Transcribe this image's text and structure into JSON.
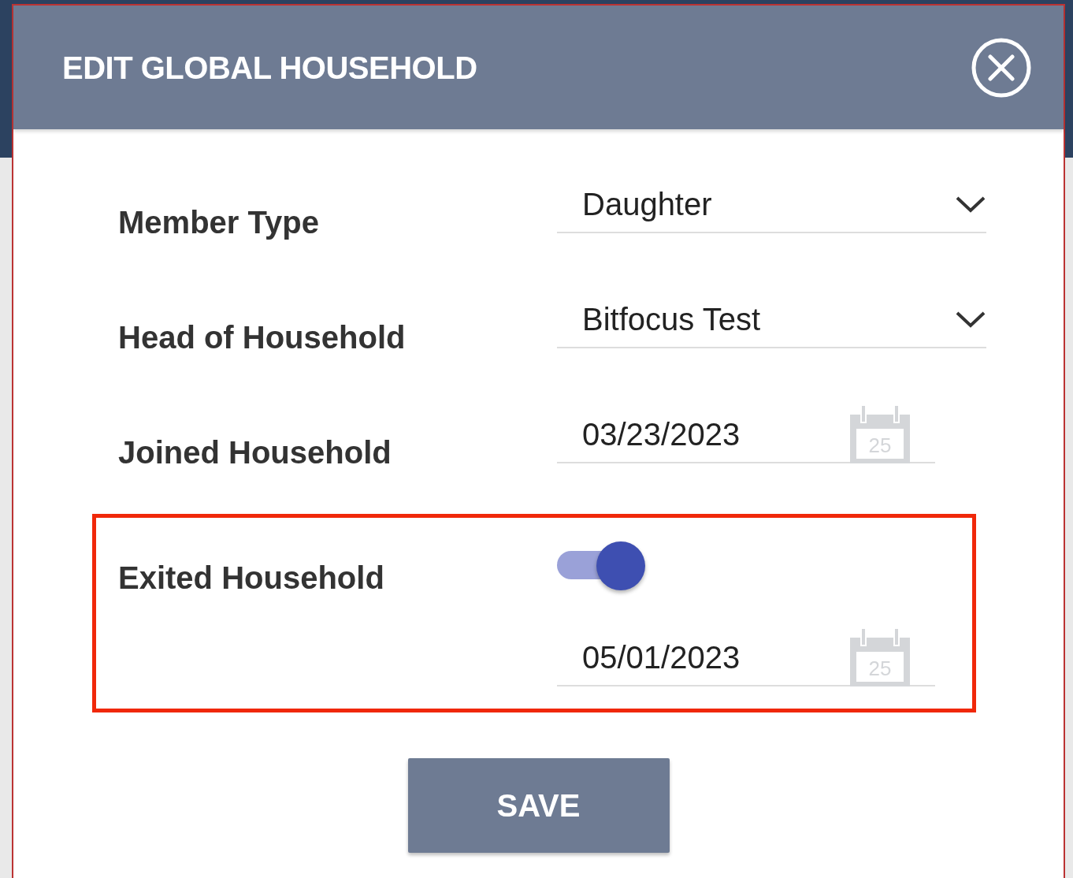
{
  "dialog": {
    "title": "EDIT GLOBAL HOUSEHOLD"
  },
  "fields": [
    {
      "kind": "select",
      "label": "Member Type",
      "value": "Daughter"
    },
    {
      "kind": "select",
      "label": "Head of Household",
      "value": "Bitfocus Test"
    },
    {
      "kind": "date",
      "label": "Joined Household",
      "value": "03/23/2023",
      "calendar_day": "25",
      "highlighted": false
    },
    {
      "kind": "toggle_date",
      "label": "Exited Household",
      "on": true,
      "value": "05/01/2023",
      "calendar_day": "25",
      "highlighted": true
    }
  ],
  "save_button": "SAVE"
}
